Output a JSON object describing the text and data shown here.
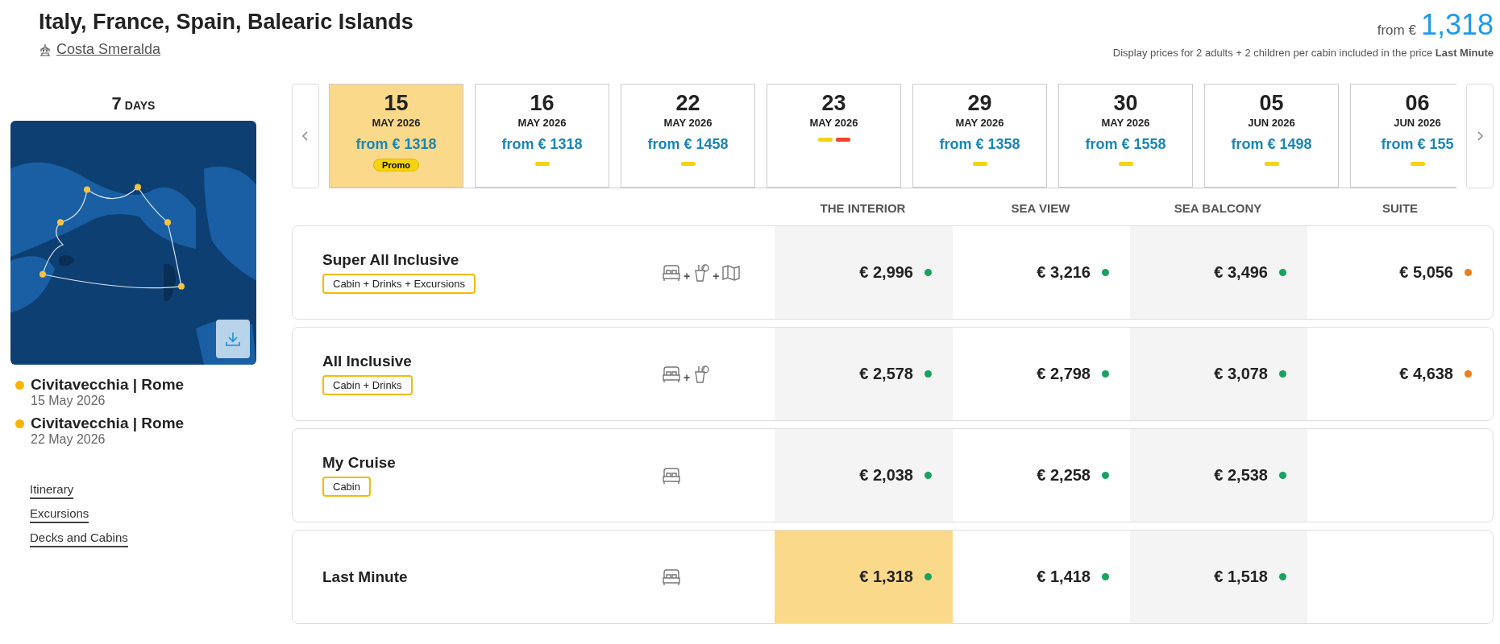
{
  "header": {
    "title": "Italy, France, Spain, Balearic Islands",
    "ship": "Costa Smeralda",
    "price_prefix": "from €",
    "price": "1,318",
    "note": "Display prices for 2 adults + 2 children per cabin included in the price **Last Minute**"
  },
  "duration": {
    "number": "7",
    "unit": "DAYS"
  },
  "map": {
    "kind": "picture"
  },
  "ports": [
    {
      "name": "Civitavecchia | Rome",
      "date": "15 May 2026"
    },
    {
      "name": "Civitavecchia | Rome",
      "date": "22 May 2026"
    }
  ],
  "links": [
    "Itinerary",
    "Excursions",
    "Decks and Cabins"
  ],
  "dates": [
    {
      "day": "15",
      "month": "MAY 2026",
      "price": "from € 1318",
      "promo": "Promo",
      "selected": true
    },
    {
      "day": "16",
      "month": "MAY 2026",
      "price": "from € 1318",
      "selected": false,
      "marks": [
        {
          "color": "#f5d312"
        }
      ]
    },
    {
      "day": "22",
      "month": "MAY 2026",
      "price": "from € 1458",
      "selected": false,
      "marks": [
        {
          "color": "#f5d312"
        }
      ]
    },
    {
      "day": "23",
      "month": "MAY 2026",
      "selected": false,
      "marks": [
        {
          "color": "#f5d312"
        },
        {
          "color": "#f0442c"
        }
      ]
    },
    {
      "day": "29",
      "month": "MAY 2026",
      "price": "from € 1358",
      "selected": false,
      "marks": [
        {
          "color": "#f5d312"
        }
      ]
    },
    {
      "day": "30",
      "month": "MAY 2026",
      "price": "from € 1558",
      "selected": false,
      "marks": [
        {
          "color": "#f5d312"
        }
      ]
    },
    {
      "day": "05",
      "month": "JUN 2026",
      "price": "from € 1498",
      "selected": false,
      "marks": [
        {
          "color": "#f5d312"
        }
      ]
    },
    {
      "day": "06",
      "month": "JUN 2026",
      "price": "from € 155",
      "selected": false,
      "marks": [
        {
          "color": "#f5d312"
        }
      ]
    }
  ],
  "columns": [
    "THE INTERIOR",
    "SEA VIEW",
    "SEA BALCONY",
    "SUITE"
  ],
  "plans": [
    {
      "name": "Super All Inclusive",
      "tag": "Cabin + Drinks + Excursions",
      "icons": [
        {
          "kind": "bed"
        },
        {
          "kind": "drink",
          "joiner": "+"
        },
        {
          "kind": "map",
          "joiner": "+"
        }
      ],
      "prices": [
        {
          "price": "€ 2,996",
          "color": "#1aa260",
          "selected": false
        },
        {
          "price": "€ 3,216",
          "color": "#1aa260",
          "selected": false
        },
        {
          "price": "€ 3,496",
          "color": "#1aa260",
          "selected": false
        },
        {
          "price": "€ 5,056",
          "color": "#f07c1b",
          "selected": false
        }
      ]
    },
    {
      "name": "All Inclusive",
      "tag": "Cabin + Drinks",
      "icons": [
        {
          "kind": "bed"
        },
        {
          "kind": "drink",
          "joiner": "+"
        }
      ],
      "prices": [
        {
          "price": "€ 2,578",
          "color": "#1aa260",
          "selected": false
        },
        {
          "price": "€ 2,798",
          "color": "#1aa260",
          "selected": false
        },
        {
          "price": "€ 3,078",
          "color": "#1aa260",
          "selected": false
        },
        {
          "price": "€ 4,638",
          "color": "#f07c1b",
          "selected": false
        }
      ]
    },
    {
      "name": "My Cruise",
      "tag": "Cabin",
      "icons": [
        {
          "kind": "bed"
        }
      ],
      "prices": [
        {
          "price": "€ 2,038",
          "color": "#1aa260",
          "selected": false
        },
        {
          "price": "€ 2,258",
          "color": "#1aa260",
          "selected": false
        },
        {
          "price": "€ 2,538",
          "color": "#1aa260",
          "selected": false
        }
      ]
    },
    {
      "name": "Last Minute",
      "icons": [
        {
          "kind": "bed"
        }
      ],
      "prices": [
        {
          "price": "€ 1,318",
          "color": "#1aa260",
          "selected": true
        },
        {
          "price": "€ 1,418",
          "color": "#1aa260",
          "selected": false
        },
        {
          "price": "€ 1,518",
          "color": "#1aa260",
          "selected": false
        }
      ]
    }
  ]
}
